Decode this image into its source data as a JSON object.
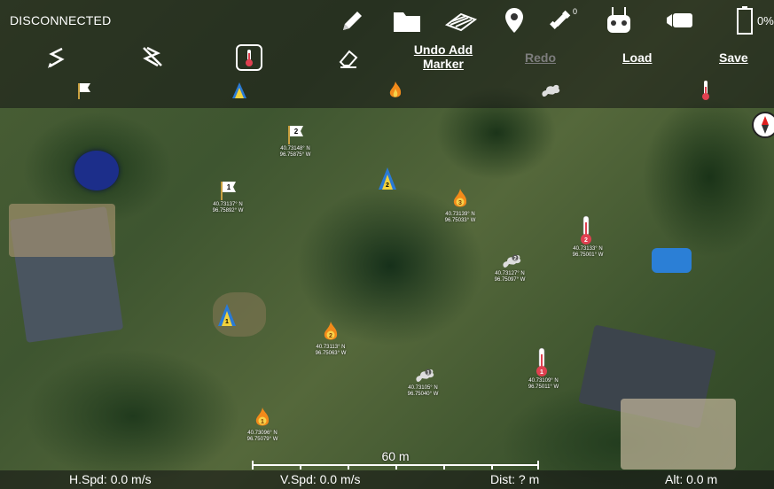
{
  "status": {
    "connection": "DISCONNECTED",
    "gps_count": "0",
    "battery": "0%"
  },
  "toolbar": {
    "undo_label": "Undo Add Marker",
    "redo_label": "Redo",
    "load_label": "Load",
    "save_label": "Save"
  },
  "markers": [
    {
      "type": "flag",
      "num": "2",
      "coord_lat": "40.73148° N",
      "coord_lon": "96.75875° W"
    },
    {
      "type": "flag",
      "num": "1",
      "coord_lat": "40.73137° N",
      "coord_lon": "96.75892° W"
    },
    {
      "type": "fire",
      "num": "3",
      "coord_lat": "40.73139° N",
      "coord_lon": "96.75033° W"
    },
    {
      "type": "thermometer",
      "num": "2",
      "coord_lat": "40.73133° N",
      "coord_lon": "96.75001° W"
    },
    {
      "type": "smoke",
      "num": "2",
      "coord_lat": "40.73127° N",
      "coord_lon": "96.75097° W"
    },
    {
      "type": "fire",
      "num": "2",
      "coord_lat": "40.73113° N",
      "coord_lon": "96.75063° W"
    },
    {
      "type": "thermometer",
      "num": "1",
      "coord_lat": "40.73109° N",
      "coord_lon": "96.75011° W"
    },
    {
      "type": "smoke",
      "num": "1",
      "coord_lat": "40.73105° N",
      "coord_lon": "96.75040° W"
    },
    {
      "type": "fire",
      "num": "1",
      "coord_lat": "40.73096° N",
      "coord_lon": "96.75079° W"
    },
    {
      "type": "tent",
      "num": "2",
      "coord_lat": "",
      "coord_lon": ""
    },
    {
      "type": "tent",
      "num": "1",
      "coord_lat": "",
      "coord_lon": ""
    }
  ],
  "scale": {
    "label": "60 m"
  },
  "bottom": {
    "hspd": "H.Spd: 0.0 m/s",
    "vspd": "V.Spd: 0.0 m/s",
    "dist": "Dist: ? m",
    "alt": "Alt: 0.0 m"
  }
}
